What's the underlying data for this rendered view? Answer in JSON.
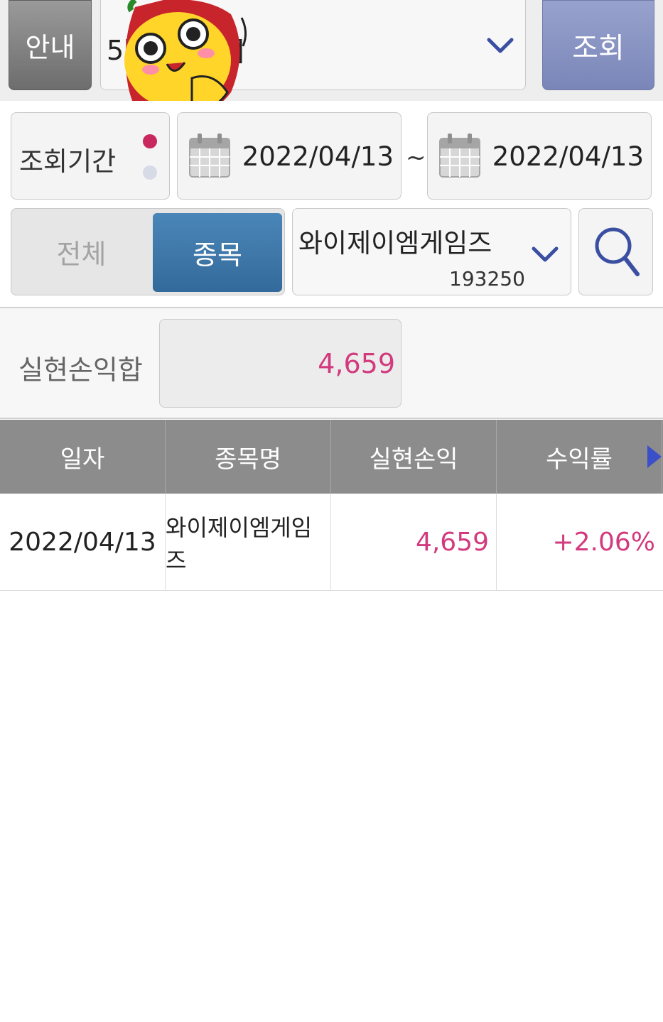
{
  "header": {
    "info_button": "안내",
    "account_label": "5[위탁종합]",
    "query_button": "조회"
  },
  "period": {
    "label": "조회기간",
    "start_date": "2022/04/13",
    "separator": "~",
    "end_date": "2022/04/13"
  },
  "filter": {
    "all_label": "전체",
    "stock_label": "종목",
    "selected_stock_name": "와이제이엠게임즈",
    "selected_stock_code": "193250"
  },
  "summary": {
    "label": "실현손익합",
    "value": "4,659"
  },
  "table": {
    "columns": [
      "일자",
      "종목명",
      "실현손익",
      "수익률"
    ],
    "rows": [
      {
        "date": "2022/04/13",
        "name": "와이제이엠게임즈",
        "profit": "4,659",
        "rate": "+2.06%"
      }
    ]
  },
  "colors": {
    "accent_pink": "#d23a7d",
    "segment_active": "#3a729f",
    "query_button": "#8892c2",
    "icon_blue": "#3a4fa2"
  },
  "icons": [
    "calendar-icon",
    "chevron-down-icon",
    "search-icon",
    "scroll-right-icon",
    "mascot-sticker"
  ]
}
